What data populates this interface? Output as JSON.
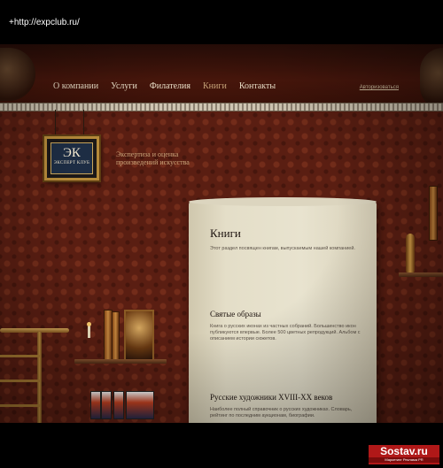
{
  "browser": {
    "url": "+http://expclub.ru/"
  },
  "nav": {
    "items": [
      {
        "label": "О компании",
        "active": false
      },
      {
        "label": "Услуги",
        "active": false
      },
      {
        "label": "Филателия",
        "active": false
      },
      {
        "label": "Книги",
        "active": true
      },
      {
        "label": "Контакты",
        "active": false
      }
    ],
    "login": "Авторизоваться"
  },
  "logo": {
    "mark": "ЭК",
    "text": "ЭКСПЕРТ КЛУБ"
  },
  "tagline": {
    "line1": "Экспертиза и оценка",
    "line2": "произведений искусства"
  },
  "content": {
    "title": "Книги",
    "intro": "Этот раздел посвящен книгам, выпускаемым нашей компанией.",
    "sections": [
      {
        "title": "Святые образы",
        "text": "Книга о русских иконах из частных собраний. Большинство икон публикуются впервые. Более 500 цветных репродукций. Альбом с описанием истории сюжетов."
      },
      {
        "title": "Русские художники XVIII-XX веков",
        "text": "Наиболее полный справочник о русских художниках. Словарь, рейтинг по последним аукционам, биографии."
      }
    ]
  },
  "watermark": {
    "main": "Sostav.ru",
    "sub": "Маркетинг Реклама PR"
  },
  "colors": {
    "accent": "#c9a57a",
    "wallpaper": "#5a1e12",
    "paper": "#e4dec8",
    "watermark": "#b01818"
  }
}
